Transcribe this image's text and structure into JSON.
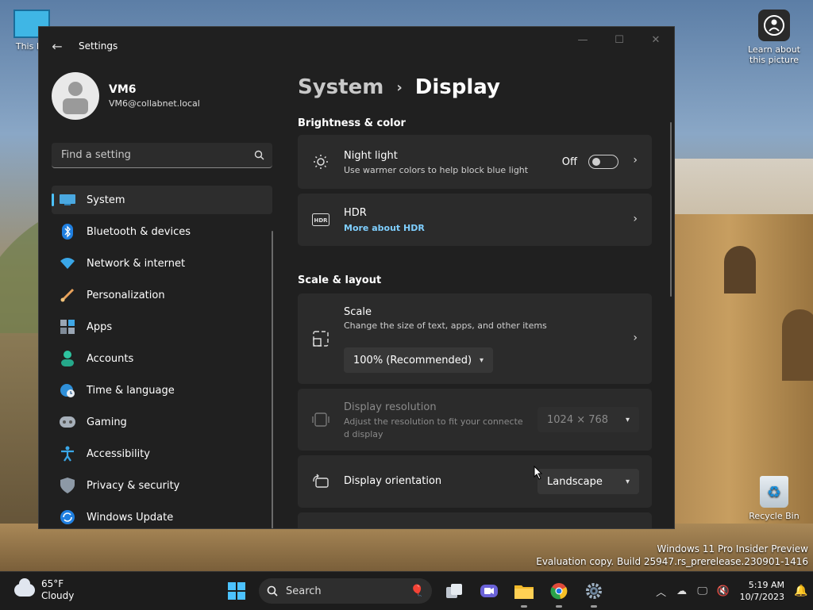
{
  "desktop": {
    "this_pc_label": "This PC",
    "learn_label_1": "Learn about",
    "learn_label_2": "this picture",
    "recycle_label": "Recycle Bin",
    "watermark_line1": "Windows 11 Pro Insider Preview",
    "watermark_line2": "Evaluation copy. Build 25947.rs_prerelease.230901-1416"
  },
  "window": {
    "title": "Settings",
    "back_icon": "back-arrow-icon",
    "controls": [
      "—",
      "☐",
      "✕"
    ]
  },
  "profile": {
    "name": "VM6",
    "email": "VM6@collabnet.local"
  },
  "search": {
    "placeholder": "Find a setting"
  },
  "sidebar": {
    "items": [
      {
        "label": "System",
        "icon": "monitor-icon",
        "active": true
      },
      {
        "label": "Bluetooth & devices",
        "icon": "bluetooth-icon"
      },
      {
        "label": "Network & internet",
        "icon": "wifi-icon"
      },
      {
        "label": "Personalization",
        "icon": "brush-icon"
      },
      {
        "label": "Apps",
        "icon": "apps-icon"
      },
      {
        "label": "Accounts",
        "icon": "person-icon"
      },
      {
        "label": "Time & language",
        "icon": "globe-clock-icon"
      },
      {
        "label": "Gaming",
        "icon": "gamepad-icon"
      },
      {
        "label": "Accessibility",
        "icon": "accessibility-icon"
      },
      {
        "label": "Privacy & security",
        "icon": "shield-icon"
      },
      {
        "label": "Windows Update",
        "icon": "update-icon"
      }
    ]
  },
  "breadcrumb": {
    "parent": "System",
    "separator": "›",
    "current": "Display"
  },
  "brightness_section": {
    "title": "Brightness & color",
    "night_light": {
      "title": "Night light",
      "subtitle": "Use warmer colors to help block blue light",
      "state": "Off"
    },
    "hdr": {
      "title": "HDR",
      "link": "More about HDR"
    }
  },
  "scale_section": {
    "title": "Scale & layout",
    "scale": {
      "title": "Scale",
      "subtitle": "Change the size of text, apps, and other items",
      "value": "100% (Recommended)"
    },
    "resolution": {
      "title": "Display resolution",
      "subtitle_1": "Adjust the resolution to fit your connecte",
      "subtitle_2": "d display",
      "value": "1024 × 768"
    },
    "orientation": {
      "title": "Display orientation",
      "value": "Landscape"
    }
  },
  "taskbar": {
    "weather_temp": "65°F",
    "weather_desc": "Cloudy",
    "search_placeholder": "Search",
    "time": "5:19 AM",
    "date": "10/7/2023"
  },
  "colors": {
    "accent": "#4cc2ff",
    "window_bg": "#202020",
    "card_bg": "#2b2b2b",
    "link": "#7fcfff"
  }
}
